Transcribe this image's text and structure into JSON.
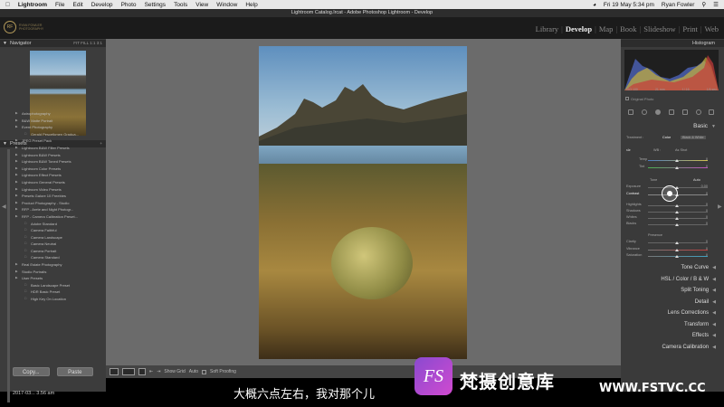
{
  "mac_menubar": {
    "app_name": "Lightroom",
    "menus": [
      "File",
      "Edit",
      "Develop",
      "Photo",
      "Settings",
      "Tools",
      "View",
      "Window",
      "Help"
    ],
    "clock": "Fri 19 May 5:34 pm",
    "user": "Ryan Fowler"
  },
  "window": {
    "title": "Lightroom Catalog.lrcat - Adobe Photoshop Lightroom - Develop"
  },
  "identity_plate": {
    "line1": "RYAN FOWLER",
    "line2": "PHOTOGRAPHY"
  },
  "modules": {
    "items": [
      "Library",
      "Develop",
      "Map",
      "Book",
      "Slideshow",
      "Print",
      "Web"
    ],
    "active": "Develop"
  },
  "left_panel": {
    "navigator": {
      "title": "Navigator",
      "zoom_options": "FIT  FILL  1:1  3:1"
    },
    "presets": {
      "title": "Presets",
      "items": [
        {
          "label": "Astrophotography",
          "level": 1
        },
        {
          "label": "B&W Matte Portrait",
          "level": 1
        },
        {
          "label": "Event Photography",
          "level": 1
        },
        {
          "label": "Gerald Pescetkmen Gradua...",
          "level": 2
        },
        {
          "label": "JPEG Preset Pack",
          "level": 1
        },
        {
          "label": "Lightroom B&W Filter Presets",
          "level": 1
        },
        {
          "label": "Lightroom B&W Presets",
          "level": 1
        },
        {
          "label": "Lightroom B&W Toned Presets",
          "level": 1
        },
        {
          "label": "Lightroom Color Presets",
          "level": 1
        },
        {
          "label": "Lightroom Effect Presets",
          "level": 1
        },
        {
          "label": "Lightroom General Presets",
          "level": 1
        },
        {
          "label": "Lightroom Video Presets",
          "level": 1
        },
        {
          "label": "Presets Galore 10 Freebies",
          "level": 1
        },
        {
          "label": "Product Photography - Studio",
          "level": 1
        },
        {
          "label": "RFP - Arete and Night Photogr...",
          "level": 1
        },
        {
          "label": "RFP - Camera Calibration Preset...",
          "level": 1
        },
        {
          "label": "Adobe Standard",
          "level": 2
        },
        {
          "label": "Camera Faithful",
          "level": 2
        },
        {
          "label": "Camera Landscape",
          "level": 2
        },
        {
          "label": "Camera Neutral",
          "level": 2
        },
        {
          "label": "Camera Portrait",
          "level": 2
        },
        {
          "label": "Camera Standard",
          "level": 2
        },
        {
          "label": "Real Estate Photography",
          "level": 1
        },
        {
          "label": "Studio Portraits",
          "level": 1
        },
        {
          "label": "User Presets",
          "level": 1
        },
        {
          "label": "Basic Landscape Preset",
          "level": 2
        },
        {
          "label": "HDR Basic Preset",
          "level": 2
        },
        {
          "label": "High Key On Location",
          "level": 2
        }
      ]
    },
    "copy_button": "Copy...",
    "paste_button": "Paste",
    "timestamp": "2017-03... 3.56 am"
  },
  "toolbar": {
    "show_grid": "Show Grid",
    "auto": "Auto",
    "soft_proofing": "Soft Proofing"
  },
  "right_panel": {
    "histogram": {
      "title": "Histogram",
      "iso": "ISO 100",
      "focal": "21 mm",
      "aperture": "f / 16",
      "shutter": "1/6 sec"
    },
    "original_photo": "Original Photo",
    "basic": {
      "title": "Basic",
      "treatment_label": "Treatment :",
      "color": "Color",
      "bw": "Black & White",
      "wb_label": "WB :",
      "wb_value": "As Shot",
      "temp_label": "Temp",
      "tint_label": "Tint",
      "tone_label": "Tone",
      "auto": "Auto",
      "exposure_label": "Exposure",
      "exposure_value": "0.00",
      "contrast_label": "Contrast",
      "contrast_value": "0",
      "highlights_label": "Highlights",
      "shadows_label": "Shadows",
      "whites_label": "Whites",
      "blacks_label": "Blacks",
      "presence_label": "Presence",
      "clarity_label": "Clarity",
      "vibrance_label": "Vibrance",
      "saturation_label": "Saturation",
      "zero": "0"
    },
    "sections": [
      "Tone Curve",
      "HSL / Color / B & W",
      "Split Toning",
      "Detail",
      "Lens Corrections",
      "Transform",
      "Effects",
      "Camera Calibration"
    ]
  },
  "overlay": {
    "subtitle": "大概六点左右，我对那个儿",
    "watermark_logo": "FS",
    "watermark_name": "梵摄创意库",
    "watermark_url": "WWW.FSTVC.CC"
  },
  "colors": {
    "accent": "#b49a5a",
    "panel": "#3c3c3c",
    "workspace": "#6b6b6b"
  }
}
